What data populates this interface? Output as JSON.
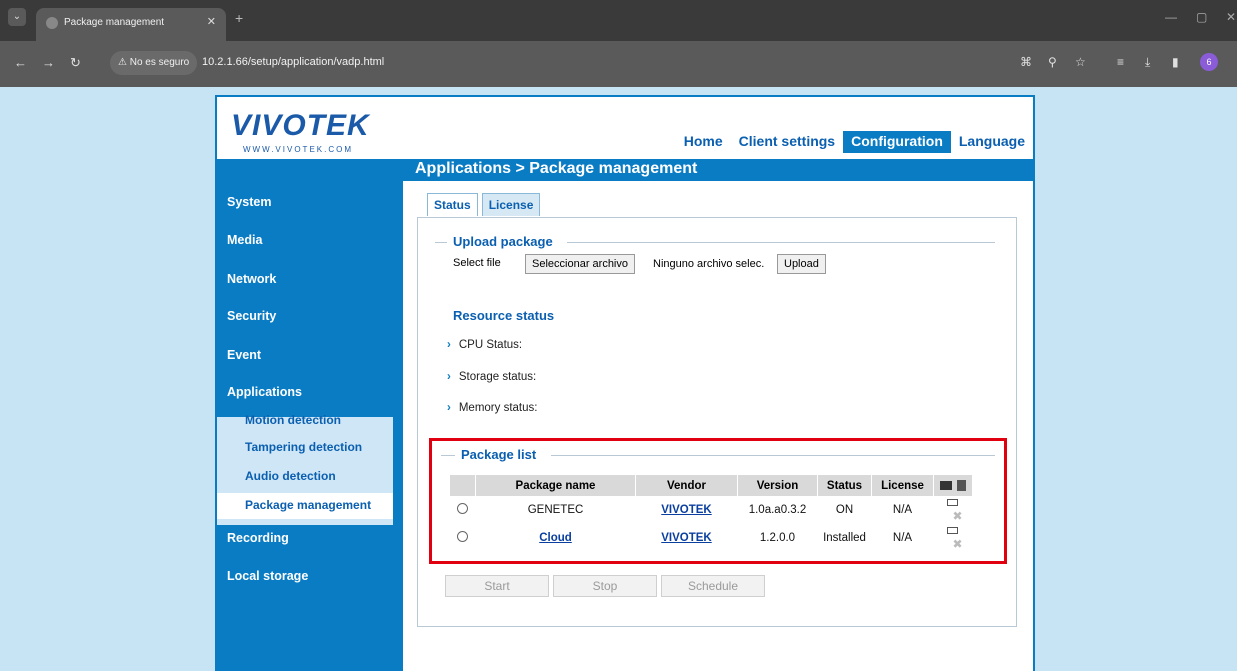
{
  "browser": {
    "tab_title": "Package management",
    "insecure_label": "⚠ No es seguro",
    "url": "10.2.1.66/setup/application/vadp.html",
    "profile_initial": "6"
  },
  "header": {
    "logo_text": "VIVOTEK",
    "logo_sub": "WWW.VIVOTEK.COM",
    "nav": [
      "Home",
      "Client settings",
      "Configuration",
      "Language"
    ]
  },
  "sidebar": {
    "items": [
      "System",
      "Media",
      "Network",
      "Security",
      "Event",
      "Applications",
      "Recording",
      "Local storage"
    ],
    "sub_items": [
      "Motion detection",
      "Tampering detection",
      "Audio detection",
      "Package management"
    ]
  },
  "title": "Applications > Package management",
  "tabs": [
    "Status",
    "License"
  ],
  "upload": {
    "heading": "Upload package",
    "select_label": "Select file",
    "choose_button": "Seleccionar archivo",
    "no_file": "Ninguno archivo selec.",
    "upload_button": "Upload"
  },
  "resource": {
    "heading": "Resource status",
    "rows": [
      "CPU Status:",
      "Storage status:",
      "Memory status:"
    ]
  },
  "package_list": {
    "heading": "Package list",
    "columns": [
      "Package name",
      "Vendor",
      "Version",
      "Status",
      "License"
    ],
    "rows": [
      {
        "name": "GENETEC",
        "vendor": "VIVOTEK",
        "version": "1.0a.a0.3.2",
        "status": "ON",
        "license": "N/A"
      },
      {
        "name": "Cloud",
        "vendor": "VIVOTEK",
        "version": "1.2.0.0",
        "status": "Installed",
        "license": "N/A"
      }
    ]
  },
  "actions": [
    "Start",
    "Stop",
    "Schedule"
  ]
}
